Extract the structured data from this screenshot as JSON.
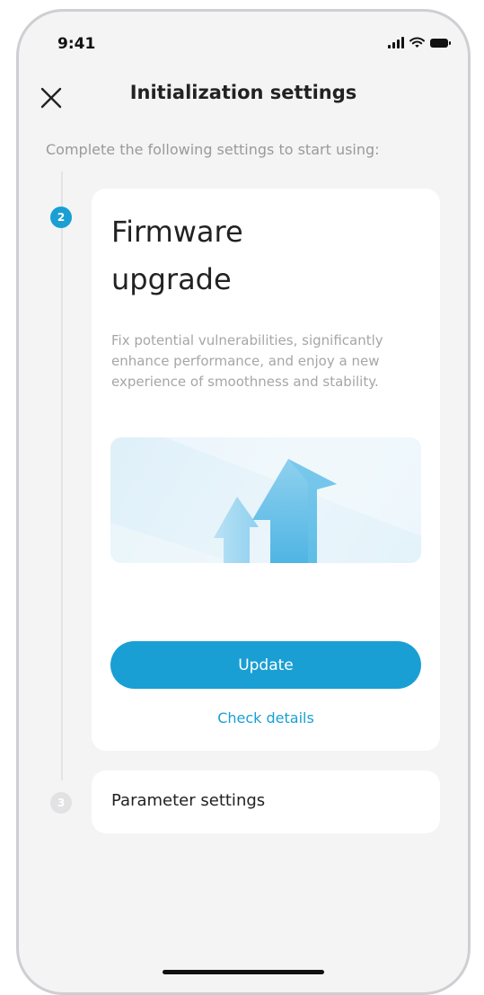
{
  "status_bar": {
    "time": "9:41"
  },
  "header": {
    "title": "Initialization settings"
  },
  "subtitle": "Complete the following settings to start using:",
  "steps": [
    {
      "number": "2",
      "title": "Firmware upgrade",
      "description": "Fix potential vulnerabilities, significantly enhance performance, and enjoy a new experience of smoothness and stability.",
      "primary_action": "Update",
      "secondary_action": "Check details"
    },
    {
      "number": "3",
      "title": "Parameter settings"
    }
  ],
  "colors": {
    "accent": "#1a9fd4",
    "background": "#f4f4f5",
    "card": "#ffffff"
  },
  "icons": {
    "close": "close-icon",
    "signal": "signal-icon",
    "wifi": "wifi-icon",
    "battery": "battery-icon"
  }
}
